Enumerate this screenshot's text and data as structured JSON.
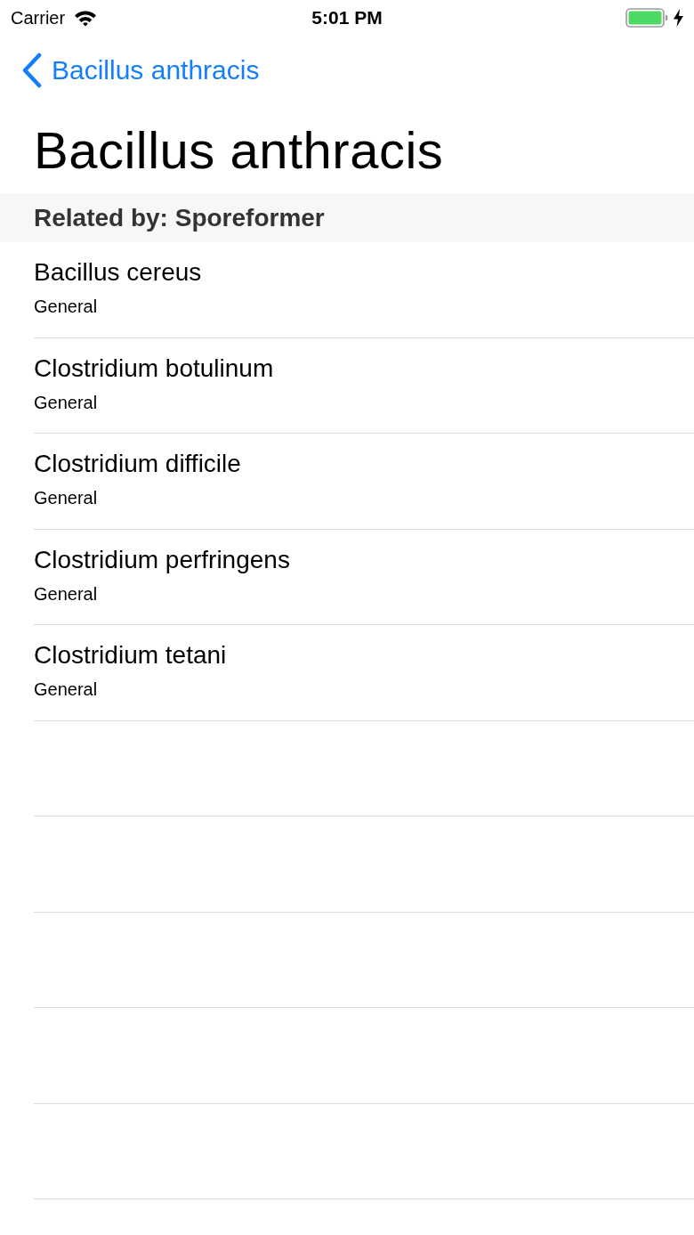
{
  "status_bar": {
    "carrier": "Carrier",
    "time": "5:01 PM",
    "charging": true
  },
  "nav_bar": {
    "back_label": "Bacillus anthracis"
  },
  "title": "Bacillus anthracis",
  "section": {
    "header": "Related by: Sporeformer",
    "rows": [
      {
        "title": "Bacillus cereus",
        "subtitle": "General"
      },
      {
        "title": "Clostridium botulinum",
        "subtitle": "General"
      },
      {
        "title": "Clostridium difficile",
        "subtitle": "General"
      },
      {
        "title": "Clostridium perfringens",
        "subtitle": "General"
      },
      {
        "title": "Clostridium tetani",
        "subtitle": "General"
      }
    ]
  }
}
